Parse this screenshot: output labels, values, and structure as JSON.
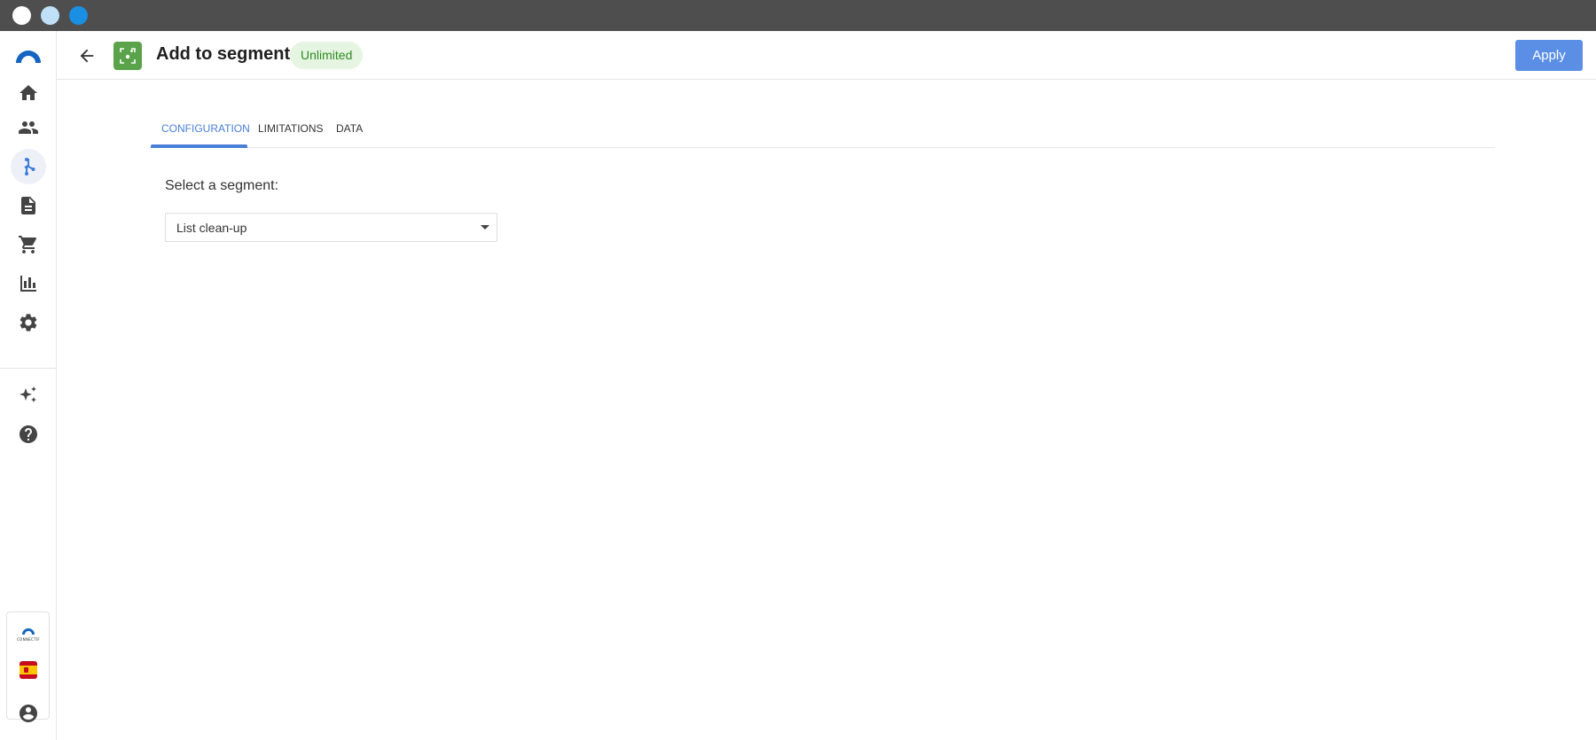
{
  "header": {
    "title": "Add to segment",
    "badge": "Unlimited",
    "apply_label": "Apply"
  },
  "sidebar": {
    "items": [
      {
        "name": "home",
        "icon": "home-icon",
        "active": false
      },
      {
        "name": "contacts",
        "icon": "people-icon",
        "active": false
      },
      {
        "name": "workflows",
        "icon": "flow-branch-icon",
        "active": true
      },
      {
        "name": "content",
        "icon": "document-icon",
        "active": false
      },
      {
        "name": "ecommerce",
        "icon": "cart-icon",
        "active": false
      },
      {
        "name": "reports",
        "icon": "bar-chart-icon",
        "active": false
      },
      {
        "name": "settings",
        "icon": "gear-icon",
        "active": false
      },
      {
        "name": "ai",
        "icon": "sparkles-icon",
        "active": false
      },
      {
        "name": "help",
        "icon": "help-circle-icon",
        "active": false
      }
    ],
    "account": {
      "brand_text": "CONNECTIF",
      "language_flag": "spain-flag-icon",
      "profile_icon": "account-circle-icon"
    }
  },
  "tabs": [
    {
      "label": "CONFIGURATION",
      "active": true
    },
    {
      "label": "LIMITATIONS",
      "active": false
    },
    {
      "label": "DATA",
      "active": false
    }
  ],
  "form": {
    "segment_label": "Select a segment:",
    "segment_value": "List clean-up"
  },
  "colors": {
    "accent": "#4a7fd6",
    "apply_button": "#5b8fe6",
    "node_icon_bg": "#5aa34a",
    "badge_bg": "#e5f5e1",
    "badge_text": "#2e8b22",
    "titlebar": "#4e4e4e"
  }
}
